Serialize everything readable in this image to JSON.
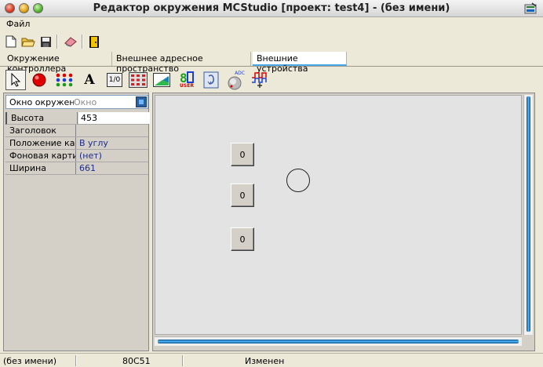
{
  "window": {
    "title": "Редактор окружения MCStudio [проект: test4] - (без имени)",
    "app_icon": "mcstudio-icon"
  },
  "menu": {
    "items": [
      "Файл"
    ]
  },
  "toolbar": {
    "buttons": [
      "new-file-icon",
      "open-folder-icon",
      "save-icon",
      "eraser-icon",
      "exit-door-icon"
    ]
  },
  "tabs": {
    "items": [
      {
        "label": "Окружение контроллера",
        "active": false
      },
      {
        "label": "Внешнее адресное пространство",
        "active": false
      },
      {
        "label": "Внешние устройства",
        "active": true
      }
    ]
  },
  "palette": {
    "tools": [
      {
        "name": "pointer-icon",
        "glyph": "↖"
      },
      {
        "name": "led-icon",
        "glyph": ""
      },
      {
        "name": "led-matrix-icon",
        "glyph": ""
      },
      {
        "name": "text-label-icon",
        "glyph": "A"
      },
      {
        "name": "io-switch-icon",
        "glyph": "1/0"
      },
      {
        "name": "keypad-icon",
        "glyph": ""
      },
      {
        "name": "lcd-display-icon",
        "glyph": ""
      },
      {
        "name": "seven-segment-icon",
        "glyph": "8"
      },
      {
        "name": "encoder-icon",
        "glyph": ""
      },
      {
        "name": "adc-knob-icon",
        "glyph": "ADC"
      },
      {
        "name": "signal-generator-icon",
        "glyph": ""
      }
    ],
    "user_label": "USER"
  },
  "object_inspector": {
    "selected_name": "Окно окружения",
    "selected_type": "Окно",
    "properties": [
      {
        "name": "Высота",
        "value": "453"
      },
      {
        "name": "Заголовок",
        "value": ""
      },
      {
        "name": "Положение картинки",
        "value": "В углу"
      },
      {
        "name": "Фоновая картинка",
        "value": "(нет)"
      },
      {
        "name": "Ширина",
        "value": "661"
      }
    ]
  },
  "canvas": {
    "buttons": [
      "0",
      "0",
      "0"
    ],
    "has_circle": true
  },
  "statusbar": {
    "filename": "(без имени)",
    "cpu": "80C51",
    "state": "Изменен"
  },
  "colors": {
    "accent": "#4aa7e8",
    "scrollbar": "#1e7fd0",
    "led_red": "#e00000"
  }
}
